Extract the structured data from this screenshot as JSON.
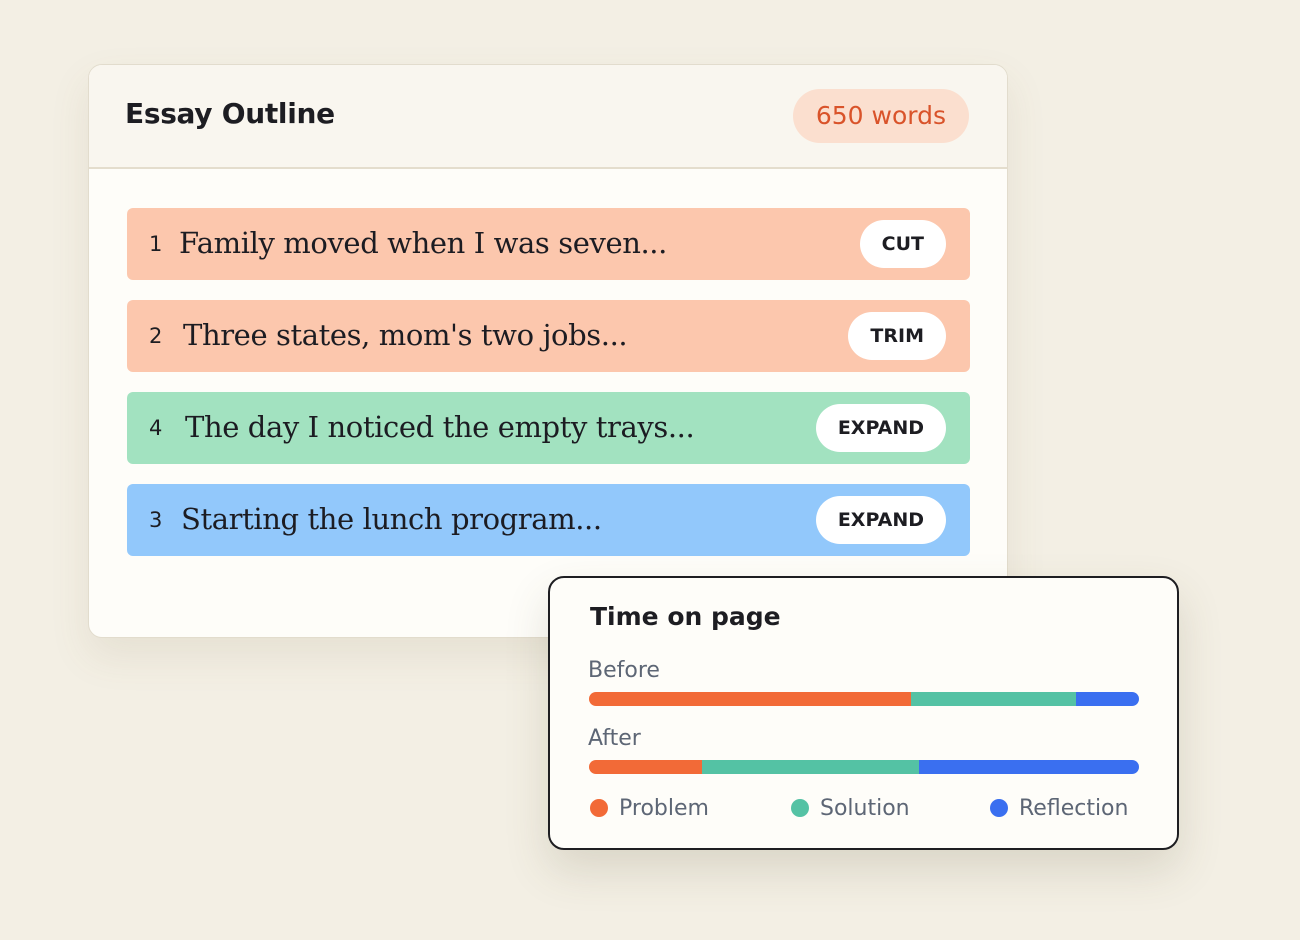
{
  "outline": {
    "title": "Essay Outline",
    "word_count": "650 words",
    "paragraphs": [
      {
        "number": "1",
        "text": "Family moved when I was seven...",
        "action": "CUT",
        "color": "#fcc7ad"
      },
      {
        "number": "2",
        "text": "Three states, mom's two jobs...",
        "action": "TRIM",
        "color": "#fcc7ad"
      },
      {
        "number": "4",
        "text": "The day I noticed the empty trays...",
        "action": "EXPAND",
        "color": "#a2e2c0"
      },
      {
        "number": "3",
        "text": "Starting the lunch program...",
        "action": "EXPAND",
        "color": "#92c8fb"
      }
    ]
  },
  "time_on_page": {
    "title": "Time on page",
    "bars": [
      {
        "label": "Before",
        "segments": {
          "problem": 0.585,
          "solution": 0.3,
          "reflection": 0.115
        }
      },
      {
        "label": "After",
        "segments": {
          "problem": 0.205,
          "solution": 0.395,
          "reflection": 0.4
        }
      }
    ],
    "legend": [
      {
        "key": "problem",
        "label": "Problem",
        "color": "#f26a37"
      },
      {
        "key": "solution",
        "label": "Solution",
        "color": "#54c2a4"
      },
      {
        "key": "reflection",
        "label": "Reflection",
        "color": "#3a6ff0"
      }
    ]
  }
}
